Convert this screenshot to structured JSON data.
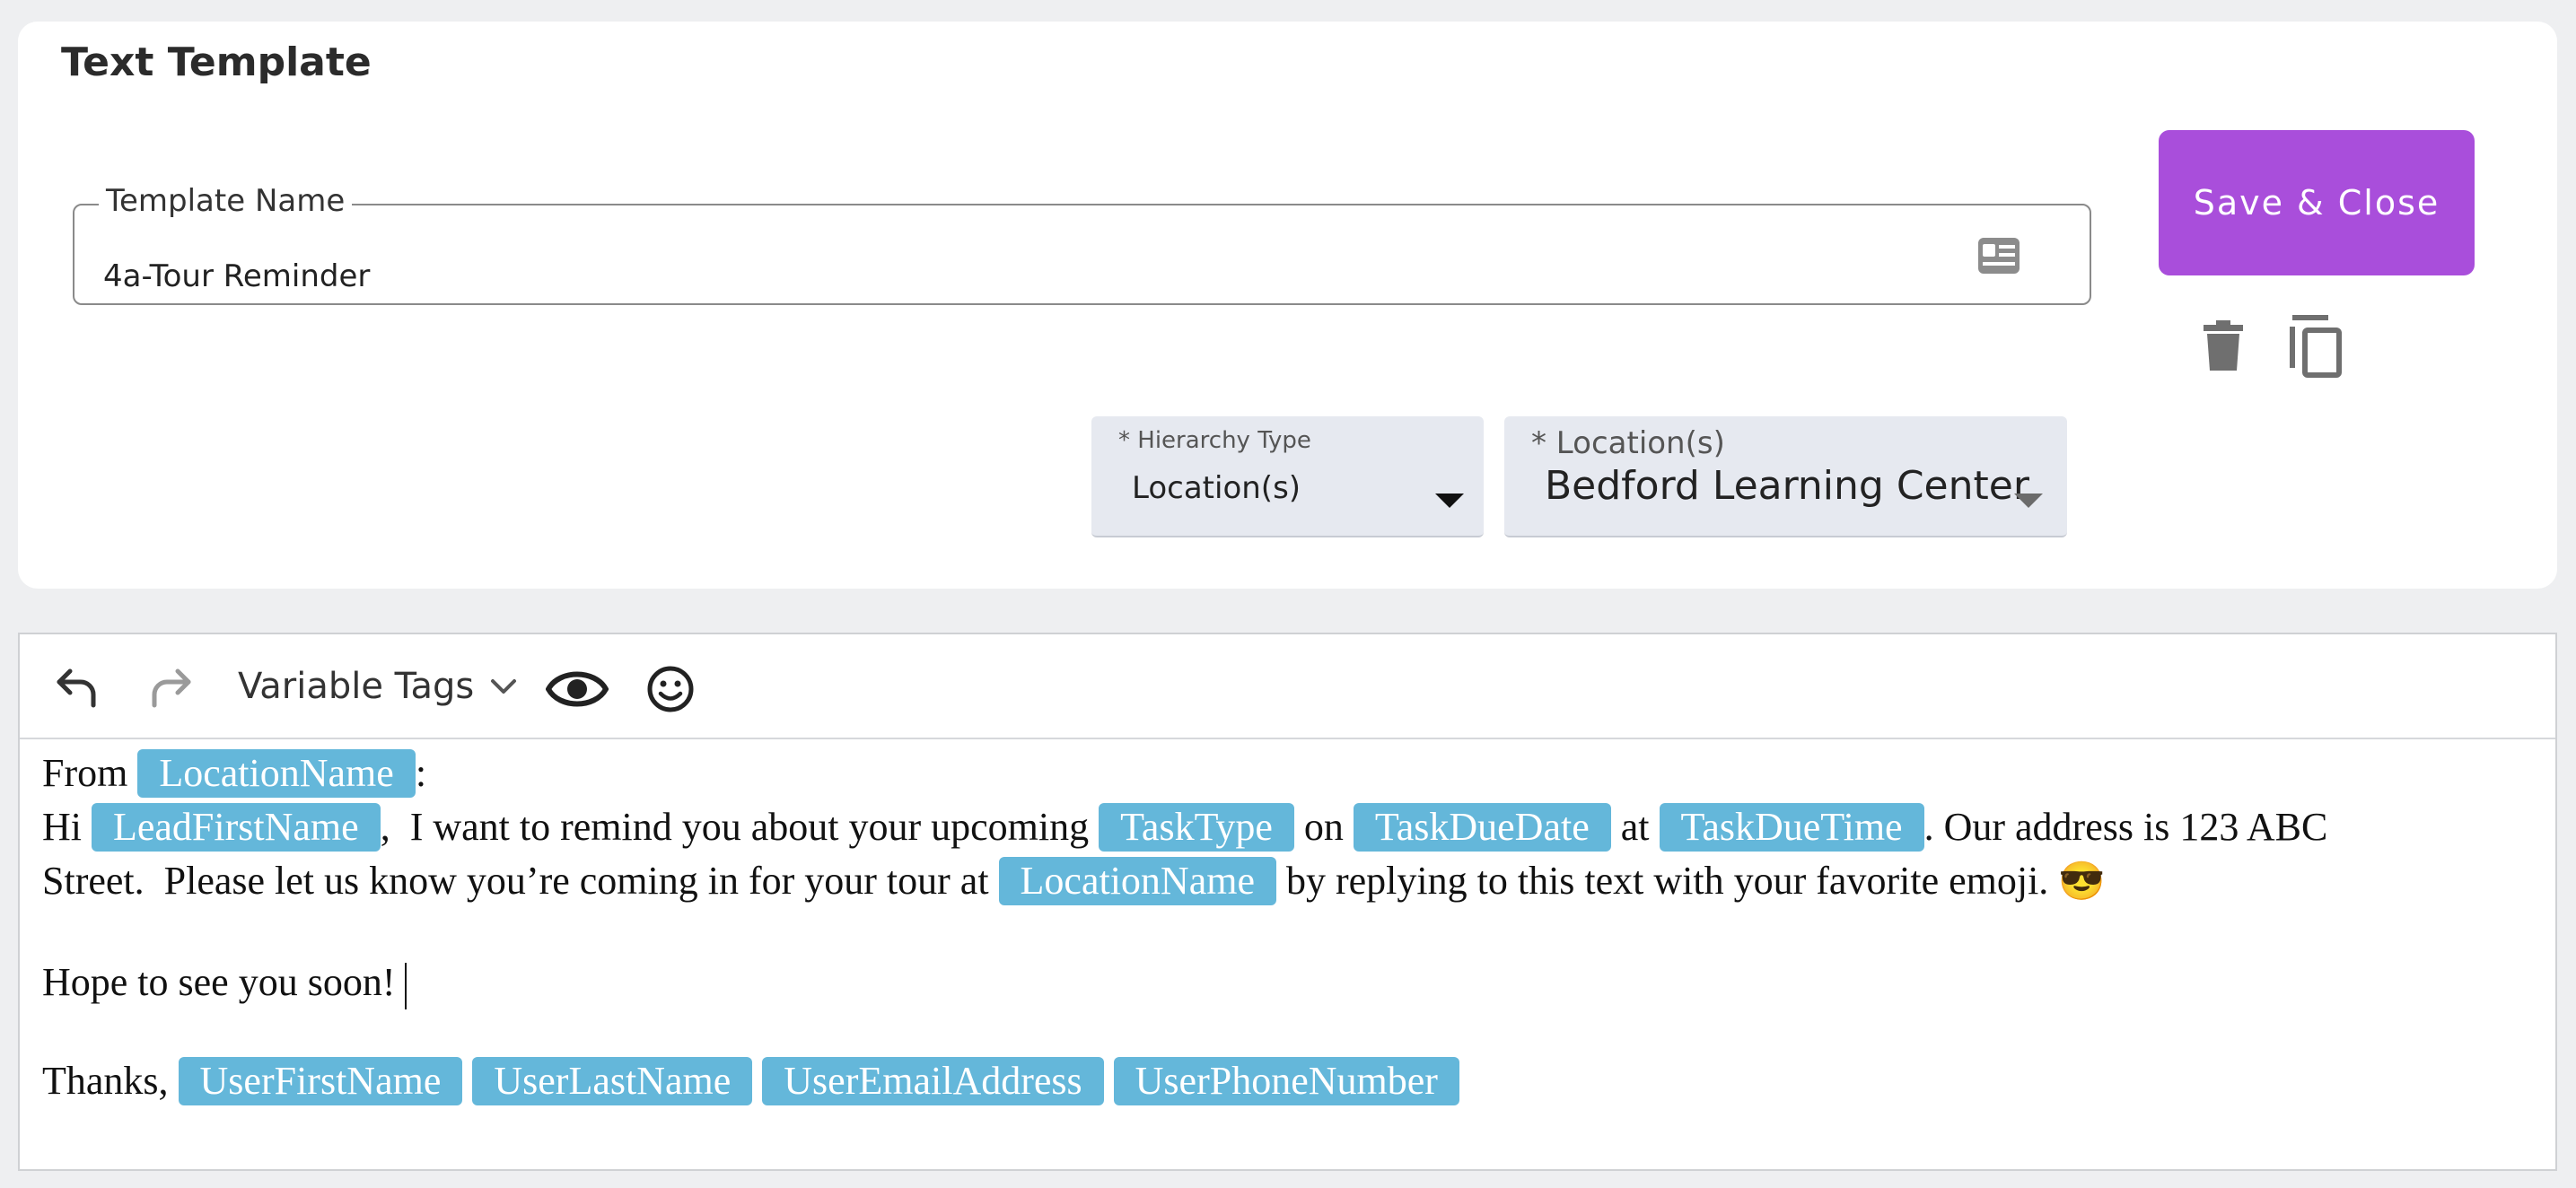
{
  "card": {
    "title": "Text Template",
    "template_name_label": "Template Name",
    "template_name_value": "4a-Tour Reminder",
    "save_label": "Save & Close",
    "hierarchy": {
      "label": "* Hierarchy Type",
      "value": "Location(s)"
    },
    "locations": {
      "label": "* Location(s)",
      "value": "Bedford Learning Center"
    }
  },
  "toolbar": {
    "variable_tags_label": "Variable Tags"
  },
  "message": {
    "l1_text_a": "From ",
    "l1_tag": "LocationName",
    "l1_text_b": ":",
    "l2_text_a": "Hi ",
    "l2_tag1": "LeadFirstName",
    "l2_text_b": ",  I want to remind you about your upcoming ",
    "l2_tag2": "TaskType",
    "l2_text_c": " on ",
    "l2_tag3": "TaskDueDate",
    "l2_text_d": " at ",
    "l2_tag4": "TaskDueTime",
    "l2_text_e": ". Our address is 123 ABC",
    "l3_text_a": "Street.  Please let us know you’re coming in for your tour at ",
    "l3_tag": "LocationName",
    "l3_text_b": " by replying to this text with your favorite emoji. ",
    "l3_emoji": "😎",
    "l4_text": "Hope to see you soon!",
    "l5_text": "Thanks, ",
    "l5_tags": [
      "UserFirstName",
      "UserLastName",
      "UserEmailAddress",
      "UserPhoneNumber"
    ]
  },
  "colors": {
    "accent": "#a94edb",
    "tag": "#64b7da"
  }
}
